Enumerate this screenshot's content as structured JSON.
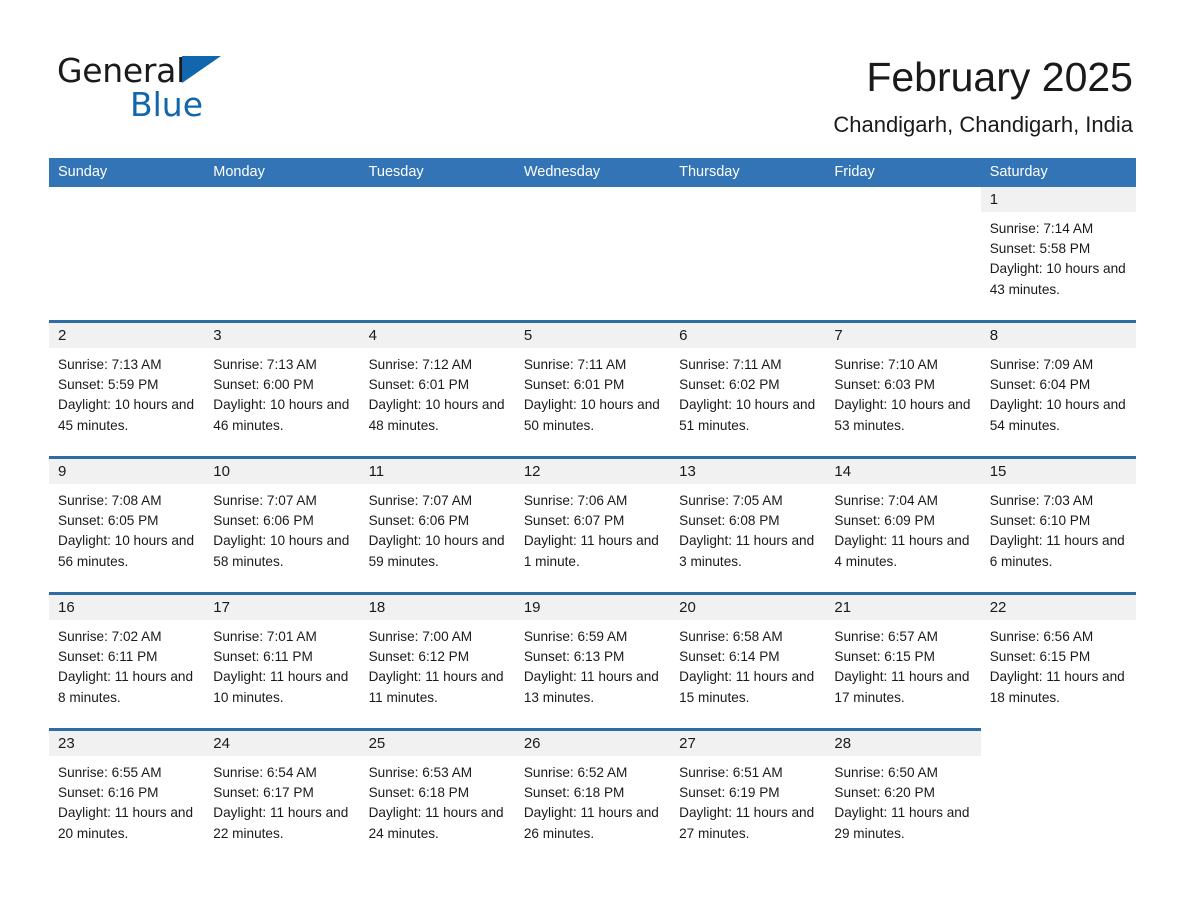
{
  "brand": {
    "name_part1": "General",
    "name_part2": "Blue",
    "triangle_color": "#1266ad"
  },
  "header": {
    "title": "February 2025",
    "subtitle": "Chandigarh, Chandigarh, India"
  },
  "theme": {
    "header_blue": "#3274b5",
    "rule_blue": "#2e6da4",
    "date_band_gray": "#f1f1f1",
    "text_black": "#1a1a1a"
  },
  "weekday_headers": [
    "Sunday",
    "Monday",
    "Tuesday",
    "Wednesday",
    "Thursday",
    "Friday",
    "Saturday"
  ],
  "weeks": [
    [
      {
        "day": "",
        "sunrise": "",
        "sunset": "",
        "daylight": "",
        "empty": true,
        "blank": true
      },
      {
        "day": "",
        "sunrise": "",
        "sunset": "",
        "daylight": "",
        "empty": true,
        "blank": true
      },
      {
        "day": "",
        "sunrise": "",
        "sunset": "",
        "daylight": "",
        "empty": true,
        "blank": true
      },
      {
        "day": "",
        "sunrise": "",
        "sunset": "",
        "daylight": "",
        "empty": true,
        "blank": true
      },
      {
        "day": "",
        "sunrise": "",
        "sunset": "",
        "daylight": "",
        "empty": true,
        "blank": true
      },
      {
        "day": "",
        "sunrise": "",
        "sunset": "",
        "daylight": "",
        "empty": true,
        "blank": true
      },
      {
        "day": "1",
        "sunrise": "Sunrise: 7:14 AM",
        "sunset": "Sunset: 5:58 PM",
        "daylight": "Daylight: 10 hours and 43 minutes."
      }
    ],
    [
      {
        "day": "2",
        "sunrise": "Sunrise: 7:13 AM",
        "sunset": "Sunset: 5:59 PM",
        "daylight": "Daylight: 10 hours and 45 minutes."
      },
      {
        "day": "3",
        "sunrise": "Sunrise: 7:13 AM",
        "sunset": "Sunset: 6:00 PM",
        "daylight": "Daylight: 10 hours and 46 minutes."
      },
      {
        "day": "4",
        "sunrise": "Sunrise: 7:12 AM",
        "sunset": "Sunset: 6:01 PM",
        "daylight": "Daylight: 10 hours and 48 minutes."
      },
      {
        "day": "5",
        "sunrise": "Sunrise: 7:11 AM",
        "sunset": "Sunset: 6:01 PM",
        "daylight": "Daylight: 10 hours and 50 minutes."
      },
      {
        "day": "6",
        "sunrise": "Sunrise: 7:11 AM",
        "sunset": "Sunset: 6:02 PM",
        "daylight": "Daylight: 10 hours and 51 minutes."
      },
      {
        "day": "7",
        "sunrise": "Sunrise: 7:10 AM",
        "sunset": "Sunset: 6:03 PM",
        "daylight": "Daylight: 10 hours and 53 minutes."
      },
      {
        "day": "8",
        "sunrise": "Sunrise: 7:09 AM",
        "sunset": "Sunset: 6:04 PM",
        "daylight": "Daylight: 10 hours and 54 minutes."
      }
    ],
    [
      {
        "day": "9",
        "sunrise": "Sunrise: 7:08 AM",
        "sunset": "Sunset: 6:05 PM",
        "daylight": "Daylight: 10 hours and 56 minutes."
      },
      {
        "day": "10",
        "sunrise": "Sunrise: 7:07 AM",
        "sunset": "Sunset: 6:06 PM",
        "daylight": "Daylight: 10 hours and 58 minutes."
      },
      {
        "day": "11",
        "sunrise": "Sunrise: 7:07 AM",
        "sunset": "Sunset: 6:06 PM",
        "daylight": "Daylight: 10 hours and 59 minutes."
      },
      {
        "day": "12",
        "sunrise": "Sunrise: 7:06 AM",
        "sunset": "Sunset: 6:07 PM",
        "daylight": "Daylight: 11 hours and 1 minute."
      },
      {
        "day": "13",
        "sunrise": "Sunrise: 7:05 AM",
        "sunset": "Sunset: 6:08 PM",
        "daylight": "Daylight: 11 hours and 3 minutes."
      },
      {
        "day": "14",
        "sunrise": "Sunrise: 7:04 AM",
        "sunset": "Sunset: 6:09 PM",
        "daylight": "Daylight: 11 hours and 4 minutes."
      },
      {
        "day": "15",
        "sunrise": "Sunrise: 7:03 AM",
        "sunset": "Sunset: 6:10 PM",
        "daylight": "Daylight: 11 hours and 6 minutes."
      }
    ],
    [
      {
        "day": "16",
        "sunrise": "Sunrise: 7:02 AM",
        "sunset": "Sunset: 6:11 PM",
        "daylight": "Daylight: 11 hours and 8 minutes."
      },
      {
        "day": "17",
        "sunrise": "Sunrise: 7:01 AM",
        "sunset": "Sunset: 6:11 PM",
        "daylight": "Daylight: 11 hours and 10 minutes."
      },
      {
        "day": "18",
        "sunrise": "Sunrise: 7:00 AM",
        "sunset": "Sunset: 6:12 PM",
        "daylight": "Daylight: 11 hours and 11 minutes."
      },
      {
        "day": "19",
        "sunrise": "Sunrise: 6:59 AM",
        "sunset": "Sunset: 6:13 PM",
        "daylight": "Daylight: 11 hours and 13 minutes."
      },
      {
        "day": "20",
        "sunrise": "Sunrise: 6:58 AM",
        "sunset": "Sunset: 6:14 PM",
        "daylight": "Daylight: 11 hours and 15 minutes."
      },
      {
        "day": "21",
        "sunrise": "Sunrise: 6:57 AM",
        "sunset": "Sunset: 6:15 PM",
        "daylight": "Daylight: 11 hours and 17 minutes."
      },
      {
        "day": "22",
        "sunrise": "Sunrise: 6:56 AM",
        "sunset": "Sunset: 6:15 PM",
        "daylight": "Daylight: 11 hours and 18 minutes."
      }
    ],
    [
      {
        "day": "23",
        "sunrise": "Sunrise: 6:55 AM",
        "sunset": "Sunset: 6:16 PM",
        "daylight": "Daylight: 11 hours and 20 minutes."
      },
      {
        "day": "24",
        "sunrise": "Sunrise: 6:54 AM",
        "sunset": "Sunset: 6:17 PM",
        "daylight": "Daylight: 11 hours and 22 minutes."
      },
      {
        "day": "25",
        "sunrise": "Sunrise: 6:53 AM",
        "sunset": "Sunset: 6:18 PM",
        "daylight": "Daylight: 11 hours and 24 minutes."
      },
      {
        "day": "26",
        "sunrise": "Sunrise: 6:52 AM",
        "sunset": "Sunset: 6:18 PM",
        "daylight": "Daylight: 11 hours and 26 minutes."
      },
      {
        "day": "27",
        "sunrise": "Sunrise: 6:51 AM",
        "sunset": "Sunset: 6:19 PM",
        "daylight": "Daylight: 11 hours and 27 minutes."
      },
      {
        "day": "28",
        "sunrise": "Sunrise: 6:50 AM",
        "sunset": "Sunset: 6:20 PM",
        "daylight": "Daylight: 11 hours and 29 minutes."
      },
      {
        "day": "",
        "sunrise": "",
        "sunset": "",
        "daylight": "",
        "empty": true,
        "blank": true,
        "no_rule": true
      }
    ]
  ]
}
